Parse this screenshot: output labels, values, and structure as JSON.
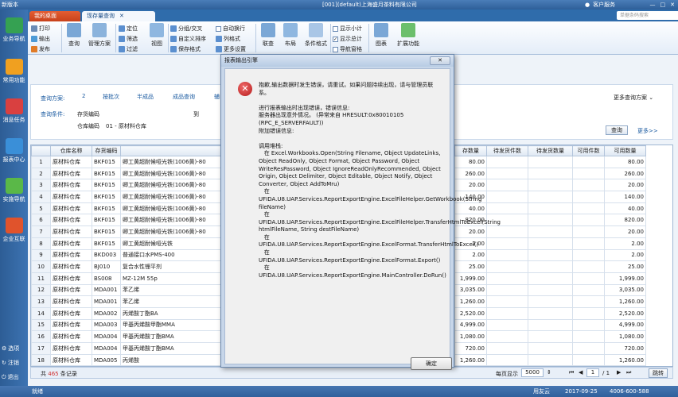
{
  "titlebar": {
    "app": "新版本",
    "center": "[001](default)上海盛月茶料有限公司",
    "user": "客户服务",
    "window_controls": [
      "—",
      "□",
      "✕"
    ]
  },
  "tabs": [
    {
      "label": "我的桌面"
    },
    {
      "label": "现存量查询"
    }
  ],
  "search_placeholder": "单据条码搜索",
  "left_nav": [
    {
      "label": "业务导航",
      "color": "#35a152"
    },
    {
      "label": "常用功能",
      "color": "#f0a020"
    },
    {
      "label": "消息任务",
      "color": "#d94040"
    },
    {
      "label": "报表中心",
      "color": "#3a8fd8"
    },
    {
      "label": "实施导航",
      "color": "#5ab848"
    },
    {
      "label": "企业互联",
      "color": "#e0532c"
    }
  ],
  "left_bottom": [
    "选项",
    "注销",
    "退出"
  ],
  "toolbar": {
    "print": "打印",
    "export": "输出",
    "publish": "发布",
    "query": "查询",
    "manage_plan": "管理方案",
    "locate": "定位",
    "filter": "筛选",
    "sort": "过滤",
    "view": "视图",
    "group": "分组/交叉",
    "custom_sort": "自定义排序",
    "save_format": "保存格式",
    "auto_wrap": "自动换行",
    "column_format": "列格式",
    "more_settings": "更多设置",
    "link": "联查",
    "layout": "布局",
    "condition_format": "条件格式",
    "show_subtotal": "显示小计",
    "show_total": "显示总计",
    "nav_bar": "导航窗格",
    "chart": "图表",
    "extend": "扩展功能"
  },
  "query_panel": {
    "plan_label": "查询方案:",
    "plan_items": [
      "2",
      "按批次",
      "半成品",
      "成品查询",
      "辅"
    ],
    "more_plans": "更多查询方案",
    "condition_label": "查询条件:",
    "inv_code_label": "存货编码",
    "to_label": "到",
    "warehouse_label": "仓库编码",
    "warehouse_value": "01 - 原材料仓库",
    "query_btn": "查询",
    "more_btn": "更多>>"
  },
  "table": {
    "headers": [
      "",
      "仓库名称",
      "存货编码",
      "存货名",
      "存数量",
      "待发货件数",
      "待发货数量",
      "可用件数",
      "可用数量"
    ],
    "rows": [
      [
        "1",
        "原材料仓库",
        "BKF015",
        "卿工黄超耐候哑光铁(1006黄)-80",
        "80.00",
        "",
        "",
        "",
        "80.00"
      ],
      [
        "2",
        "原材料仓库",
        "BKF015",
        "卿工黄超耐候哑光铁(1006黄)-80",
        "260.00",
        "",
        "",
        "",
        "260.00"
      ],
      [
        "3",
        "原材料仓库",
        "BKF015",
        "卿工黄超耐候哑光铁(1006黄)-80",
        "20.00",
        "",
        "",
        "",
        "20.00"
      ],
      [
        "4",
        "原材料仓库",
        "BKF015",
        "卿工黄超耐候哑光铁(1006黄)-80",
        "140.00",
        "",
        "",
        "",
        "140.00"
      ],
      [
        "5",
        "原材料仓库",
        "BKF015",
        "卿工黄超耐候哑光铁(1006黄)-80",
        "40.00",
        "",
        "",
        "",
        "40.00"
      ],
      [
        "6",
        "原材料仓库",
        "BKF015",
        "卿工黄超耐候哑光铁(1006黄)-80",
        "820.00",
        "",
        "",
        "",
        "820.00"
      ],
      [
        "7",
        "原材料仓库",
        "BKF015",
        "卿工黄超耐候哑光铁(1006黄)-80",
        "20.00",
        "",
        "",
        "",
        "20.00"
      ],
      [
        "8",
        "原材料仓库",
        "BKF015",
        "卿工黄超耐候哑光铁",
        "2.00",
        "",
        "",
        "",
        "2.00"
      ],
      [
        "9",
        "原材料仓库",
        "BKD003",
        "普通接口水PMS-400",
        "2.00",
        "",
        "",
        "",
        "2.00"
      ],
      [
        "10",
        "原材料仓库",
        "BJ010",
        "复合水性锂平剂",
        "25.00",
        "",
        "",
        "",
        "25.00"
      ],
      [
        "11",
        "原材料仓库",
        "BS008",
        "MZ-12M 55p",
        "1,999.00",
        "",
        "",
        "",
        "1,999.00"
      ],
      [
        "12",
        "原材料仓库",
        "MDA001",
        "苯乙烯",
        "3,035.00",
        "",
        "",
        "",
        "3,035.00"
      ],
      [
        "13",
        "原材料仓库",
        "MDA001",
        "苯乙烯",
        "1,260.00",
        "",
        "",
        "",
        "1,260.00"
      ],
      [
        "14",
        "原材料仓库",
        "MDA002",
        "丙烯酸丁酯BA",
        "2,520.00",
        "",
        "",
        "",
        "2,520.00"
      ],
      [
        "15",
        "原材料仓库",
        "MDA003",
        "甲基丙烯酸甲酯MMA",
        "4,999.00",
        "",
        "",
        "",
        "4,999.00"
      ],
      [
        "16",
        "原材料仓库",
        "MDA004",
        "甲基丙烯酸丁酯BMA",
        "1,080.00",
        "",
        "",
        "",
        "1,080.00"
      ],
      [
        "17",
        "原材料仓库",
        "MDA004",
        "甲基丙烯酸丁酯BMA",
        "720.00",
        "",
        "",
        "",
        "720.00"
      ],
      [
        "18",
        "原材料仓库",
        "MDA005",
        "丙烯酸",
        "1,260.00",
        "",
        "",
        "",
        "1,260.00"
      ],
      [
        "19",
        "原材料仓库",
        "MDA006",
        "丙烯酸羟丙酯",
        "1,260.00",
        "",
        "",
        "",
        "1,260.00"
      ]
    ]
  },
  "footer": {
    "total_prefix": "共",
    "total_count": "465",
    "total_suffix": "条记录",
    "page_size_label": "每页显示",
    "page_size": "5000",
    "page_current": "1",
    "page_total": "/ 1",
    "jump": "跳转"
  },
  "status": {
    "left": "就绪",
    "company": "用友云",
    "date": "2017-09-25",
    "phone": "4006-600-588"
  },
  "dialog": {
    "title": "报表输出引擎",
    "close": "✕",
    "message": "抱歉,输出数据时发生错误，请重试。如果问题持续出现，请与管理员联系。\n\n进行报表输出时出现错误，错误信息:\n服务器出现意外情况。 (异常来自 HRESULT:0x80010105 (RPC_E_SERVERFAULT))\n附加错误信息:\n\n调用堆栈:\n   在 Excel.Workbooks.Open(String Filename, Object UpdateLinks, Object ReadOnly, Object Format, Object Password, Object WriteResPassword, Object IgnoreReadOnlyRecommended, Object Origin, Object Delimiter, Object Editable, Object Notify, Object Converter, Object AddToMru)\n   在\nUFIDA.U8.UAP.Services.ReportExportEngine.ExcelFileHelper.GetWorkbook(String fileName)\n   在\nUFIDA.U8.UAP.Services.ReportExportEngine.ExcelFileHelper.TransferHtmlToExcel(String htmlFileName, String destFileName)\n   在\nUFIDA.U8.UAP.Services.ReportExportEngine.ExcelFormat.TransferHtmlToExcel()\n   在\nUFIDA.U8.UAP.Services.ReportExportEngine.ExcelFormat.Export()\n   在\nUFIDA.U8.UAP.Services.ReportExportEngine.MainController.DoRun()",
    "ok": "确定"
  }
}
